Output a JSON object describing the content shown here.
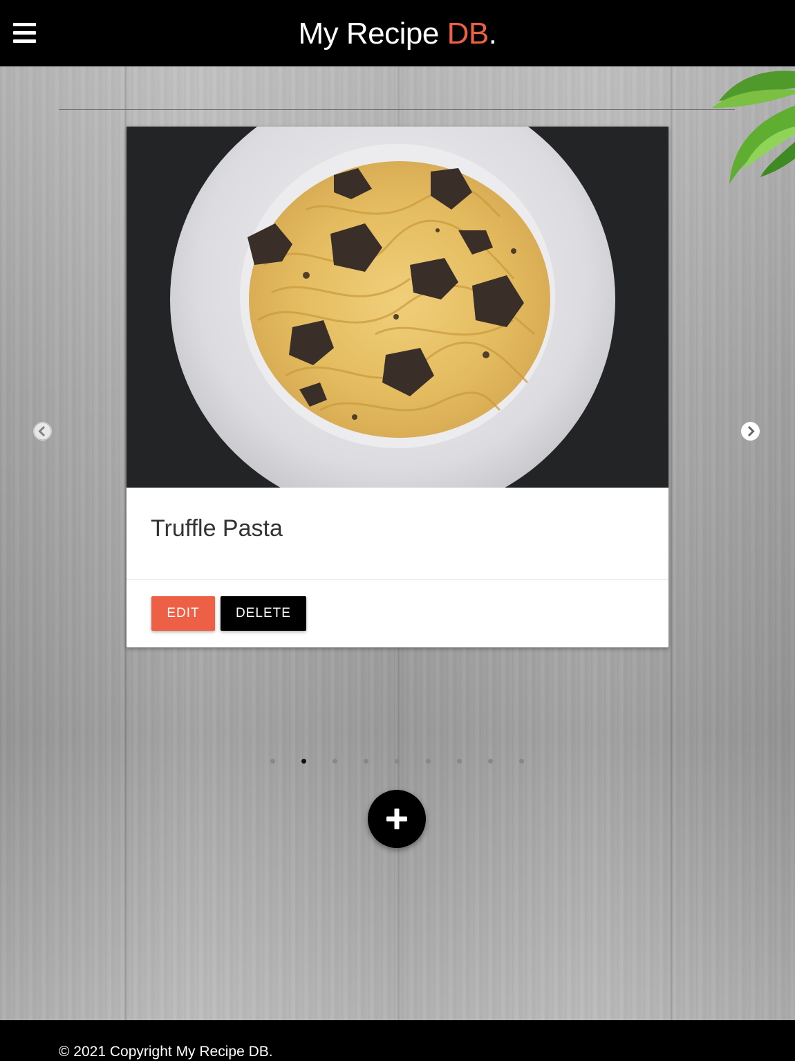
{
  "header": {
    "brand_main": "My Recipe ",
    "brand_accent": "DB",
    "brand_dot": ".",
    "menu_icon": "hamburger-icon"
  },
  "carousel": {
    "prev_icon": "chevron-left-icon",
    "next_icon": "chevron-right-icon",
    "slide_count": 9,
    "active_index": 1
  },
  "card": {
    "image_subject": "truffle-pasta-photo",
    "title": "Truffle Pasta",
    "edit_label": "EDIT",
    "delete_label": "DELETE"
  },
  "fab": {
    "icon": "plus-icon"
  },
  "footer": {
    "copyright": "© 2021 Copyright My Recipe DB."
  },
  "colors": {
    "accent": "#ee6045",
    "header_bg": "#000000",
    "footer_bg": "#000000",
    "card_bg": "#ffffff"
  }
}
